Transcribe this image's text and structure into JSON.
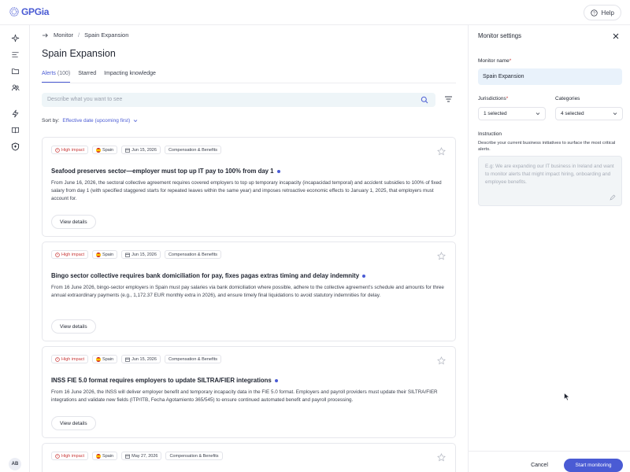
{
  "app": {
    "logo_text": "GPGia",
    "help_label": "Help",
    "avatar_initials": "AB"
  },
  "breadcrumb": {
    "parent": "Monitor",
    "separator": "/",
    "current": "Spain Expansion"
  },
  "page": {
    "title": "Spain Expansion"
  },
  "tabs": [
    {
      "label": "Alerts",
      "count": "(100)"
    },
    {
      "label": "Starred"
    },
    {
      "label": "Impacting knowledge"
    }
  ],
  "search": {
    "placeholder": "Describe what you want to see"
  },
  "sort": {
    "label": "Sort by:",
    "value": "Effective date (upcoming first)"
  },
  "alerts": [
    {
      "impact": "High impact",
      "country": "Spain",
      "date": "Jun 15, 2026",
      "category": "Compensation & Benefits",
      "title": "Seafood preserves sector—employer must top up IT pay to 100% from day 1",
      "description": "From June 16, 2026, the sectoral collective agreement requires covered employers to top up temporary incapacity (incapacidad temporal) and accident subsidies to 100% of fixed salary from day 1 (with specified staggered starts for repeated leaves within the same year) and imposes retroactive economic effects to January 1, 2025, that employers must account for.",
      "button": "View details"
    },
    {
      "impact": "High impact",
      "country": "Spain",
      "date": "Jun 15, 2026",
      "category": "Compensation & Benefits",
      "title": "Bingo sector collective requires bank domiciliation for pay, fixes pagas extras timing and delay indemnity",
      "description": "From 16 June 2026, bingo-sector employers in Spain must pay salaries via bank domiciliation where possible, adhere to the collective agreement's schedule and amounts for three annual extraordinary payments (e.g., 1,172.37 EUR monthly extra in 2026), and ensure timely final liquidations to avoid statutory indemnities for delay.",
      "button": "View details"
    },
    {
      "impact": "High impact",
      "country": "Spain",
      "date": "Jun 15, 2026",
      "category": "Compensation & Benefits",
      "title": "INSS FIE 5.0 format requires employers to update SILTRA/FIER integrations",
      "description": "From 16 June 2026, the INSS will deliver employer benefit and temporary incapacity data in the FIE 5.0 format. Employers and payroll providers must update their SILTRA/FIER integrations and validate new fields (ITP/ITB, Fecha Agotamiento 365/545) to ensure continued automated benefit and payroll processing.",
      "button": "View details"
    },
    {
      "impact": "High impact",
      "country": "Spain",
      "date": "May 27, 2026",
      "category": "Compensation & Benefits"
    }
  ],
  "settings": {
    "title": "Monitor settings",
    "name_label": "Monitor name",
    "name_value": "Spain Expansion",
    "jurisdictions_label": "Jurisdictions",
    "jurisdictions_value": "1 selected",
    "categories_label": "Categories",
    "categories_value": "4 selected",
    "instruction_label": "Instruction",
    "instruction_hint": "Describe your current business initiatives to surface the most critical alerts.",
    "instruction_placeholder": "E.g: We are expanding our IT business in Ireland and want to monitor alerts that might impact hiring, onboarding and employee benefits.",
    "required_mark": "*",
    "cancel_label": "Cancel",
    "start_label": "Start monitoring"
  },
  "colors": {
    "accent": "#4a5bd4",
    "impact": "#c83838"
  }
}
